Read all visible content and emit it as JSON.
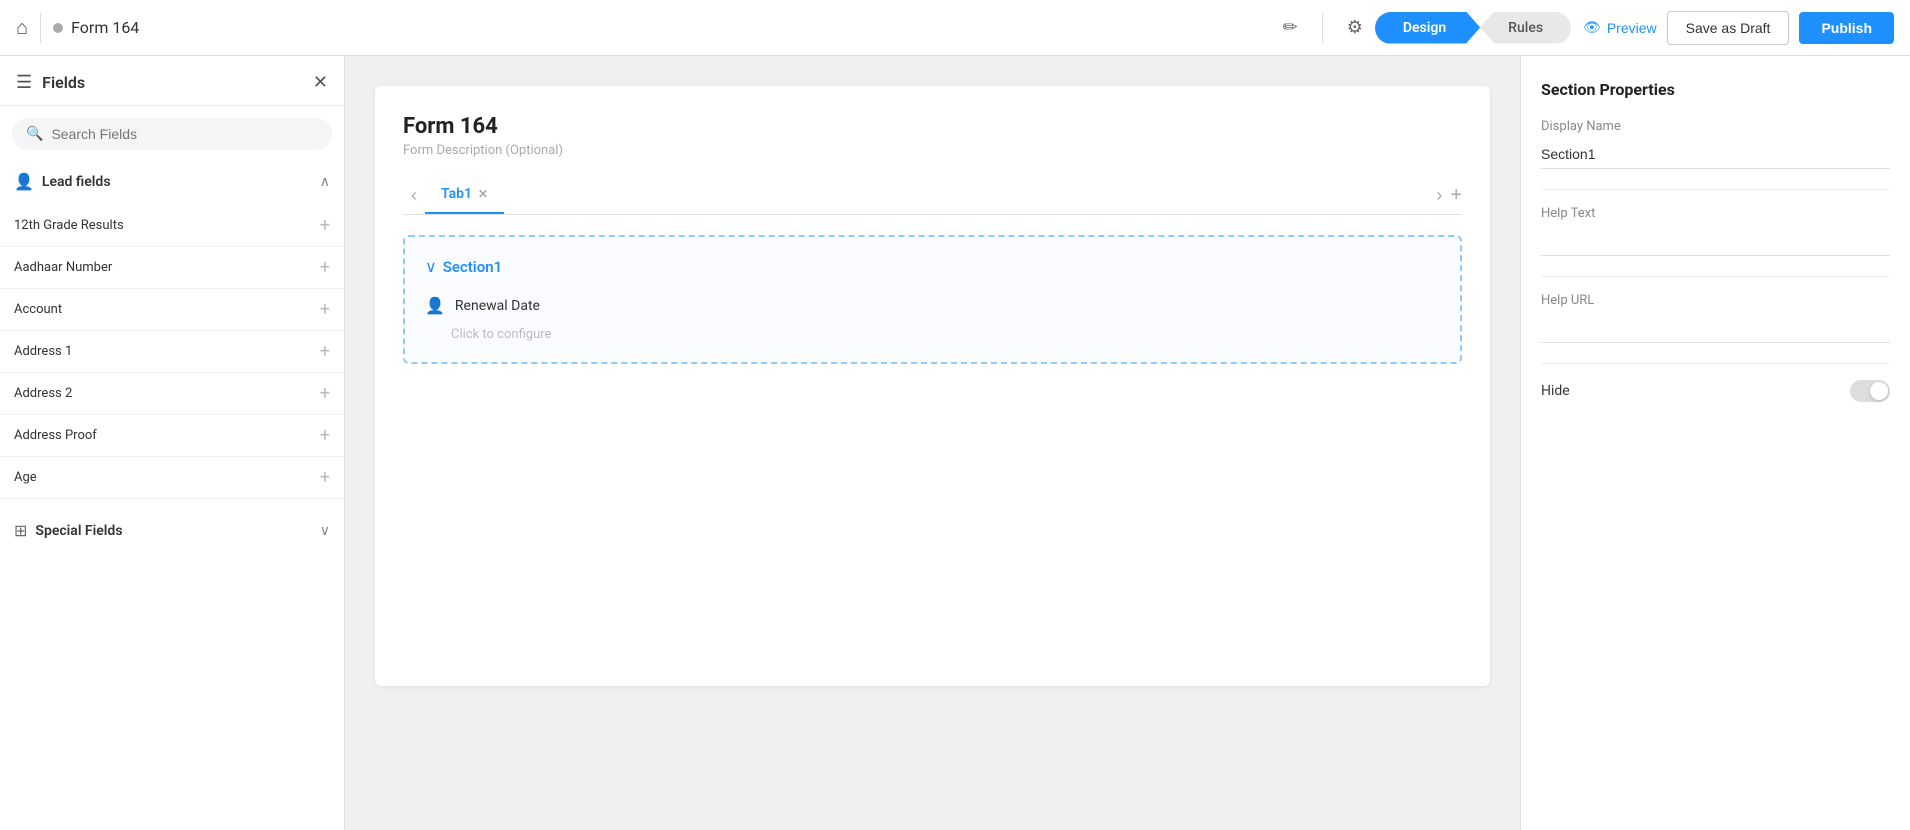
{
  "topbar": {
    "home_icon": "⌂",
    "dot_color": "#aaa",
    "title": "Form 164",
    "edit_icon": "✎",
    "settings_icon": "⚙",
    "tab_design": "Design",
    "tab_rules": "Rules",
    "preview_label": "Preview",
    "preview_icon": "👁",
    "save_draft_label": "Save as Draft",
    "publish_label": "Publish"
  },
  "sidebar": {
    "title": "Fields",
    "search_placeholder": "Search Fields",
    "sections": [
      {
        "id": "lead-fields",
        "label": "Lead fields",
        "icon": "👤",
        "expanded": true,
        "fields": [
          {
            "name": "12th Grade Results"
          },
          {
            "name": "Aadhaar Number"
          },
          {
            "name": "Account"
          },
          {
            "name": "Address 1"
          },
          {
            "name": "Address 2"
          },
          {
            "name": "Address Proof"
          },
          {
            "name": "Age"
          }
        ]
      },
      {
        "id": "special-fields",
        "label": "Special Fields",
        "icon": "⊞",
        "expanded": false,
        "fields": []
      }
    ]
  },
  "canvas": {
    "form_title": "Form 164",
    "form_description": "Form Description (Optional)",
    "tabs": [
      {
        "label": "Tab1",
        "active": true
      }
    ],
    "sections": [
      {
        "name": "Section1",
        "fields": [
          {
            "label": "Renewal Date"
          }
        ],
        "configure_hint": "Click to configure"
      }
    ]
  },
  "right_panel": {
    "title": "Section Properties",
    "display_name_label": "Display Name",
    "display_name_value": "Section1",
    "help_text_label": "Help Text",
    "help_text_value": "",
    "help_url_label": "Help URL",
    "help_url_value": "",
    "hide_label": "Hide",
    "hide_value": false
  }
}
